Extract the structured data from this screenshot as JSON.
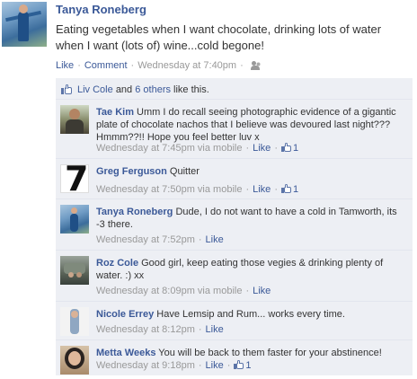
{
  "post": {
    "author": "Tanya Roneberg",
    "text": "Eating vegetables when I want chocolate, drinking lots of water when I want (lots of) wine...cold begone!",
    "actions": {
      "like": "Like",
      "comment": "Comment",
      "timestamp": "Wednesday at 7:40pm",
      "audience_icon": "people-icon"
    }
  },
  "likes": {
    "person": "Liv Cole",
    "connector": "and",
    "others": "6 others",
    "suffix": "like this."
  },
  "comments": [
    {
      "author": "Tae Kim",
      "text": "Umm I do recall seeing photographic evidence of a gigantic plate of chocolate nachos that I believe was devoured last night??? Hmmm??!! Hope you feel better luv x",
      "timestamp": "Wednesday at 7:45pm via mobile",
      "like": "Like",
      "like_count": "1"
    },
    {
      "author": "Greg Ferguson",
      "text": "Quitter",
      "timestamp": "Wednesday at 7:50pm via mobile",
      "like": "Like",
      "like_count": "1",
      "avatar_glyph": "7"
    },
    {
      "author": "Tanya Roneberg",
      "text": "Dude, I do not want to have a cold in Tamworth, its -3 there.",
      "timestamp": "Wednesday at 7:52pm",
      "like": "Like"
    },
    {
      "author": "Roz Cole",
      "text": "Good girl, keep eating those vegies & drinking plenty of water. :) xx",
      "timestamp": "Wednesday at 8:09pm via mobile",
      "like": "Like"
    },
    {
      "author": "Nicole Errey",
      "text": "Have Lemsip and Rum... works every time.",
      "timestamp": "Wednesday at 8:12pm",
      "like": "Like"
    },
    {
      "author": "Metta Weeks",
      "text": "You will be back to them faster for your abstinence!",
      "timestamp": "Wednesday at 9:18pm",
      "like": "Like",
      "like_count": "1"
    }
  ],
  "colors": {
    "link": "#3b5998",
    "meta": "#999999",
    "ufi_background": "#edeff4"
  }
}
